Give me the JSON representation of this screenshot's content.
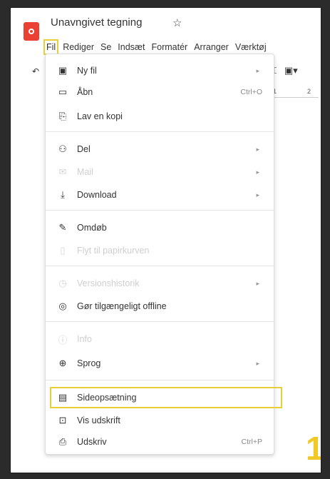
{
  "app": {
    "title": "Unavngivet tegning"
  },
  "menubar": [
    "Fil",
    "Rediger",
    "Se",
    "Indsæt",
    "Formatér",
    "Arranger",
    "Værktøj"
  ],
  "ruler": [
    "1",
    "2"
  ],
  "menu": {
    "items": [
      {
        "label": "Ny fil",
        "icon": "new-file-icon",
        "submenu": true
      },
      {
        "label": "Åbn",
        "icon": "folder-icon",
        "shortcut": "Ctrl+O"
      },
      {
        "label": "Lav en kopi",
        "icon": "copy-icon"
      },
      {
        "label": "Del",
        "icon": "share-person-icon",
        "submenu": true
      },
      {
        "label": "Mail",
        "icon": "mail-icon",
        "submenu": true,
        "disabled": true
      },
      {
        "label": "Download",
        "icon": "download-icon",
        "submenu": true
      },
      {
        "label": "Omdøb",
        "icon": "rename-icon"
      },
      {
        "label": "Flyt til papirkurven",
        "icon": "trash-icon",
        "disabled": true
      },
      {
        "label": "Versionshistorik",
        "icon": "history-icon",
        "submenu": true,
        "disabled": true
      },
      {
        "label": "Gør tilgængeligt offline",
        "icon": "offline-icon"
      },
      {
        "label": "Info",
        "icon": "info-icon",
        "disabled": true
      },
      {
        "label": "Sprog",
        "icon": "globe-icon",
        "submenu": true
      },
      {
        "label": "Sideopsætning",
        "icon": "page-setup-icon",
        "highlighted": true
      },
      {
        "label": "Vis udskrift",
        "icon": "print-preview-icon"
      },
      {
        "label": "Udskriv",
        "icon": "printer-icon",
        "shortcut": "Ctrl+P"
      }
    ]
  },
  "annotation": {
    "step": "1"
  },
  "colors": {
    "highlight": "#e8cf3a",
    "logo": "#e94235",
    "step": "#f0c928"
  }
}
